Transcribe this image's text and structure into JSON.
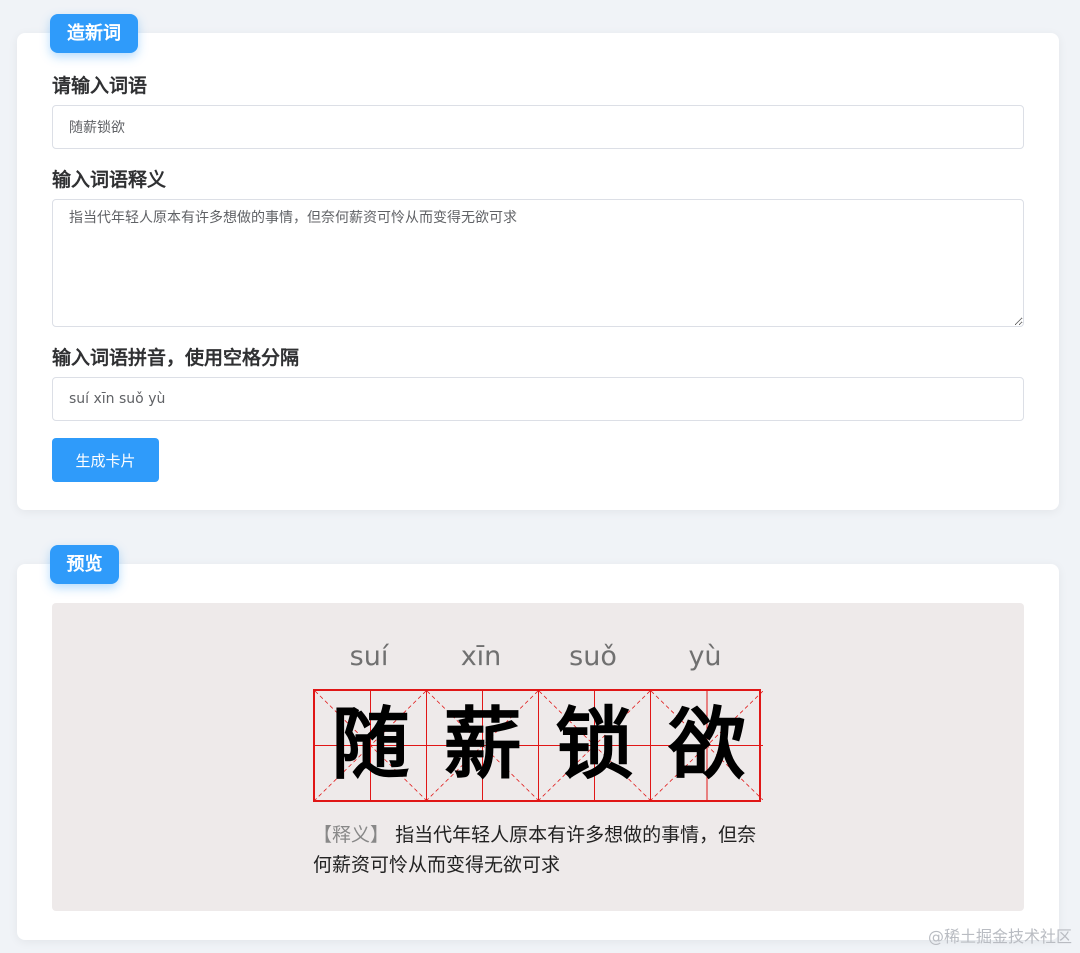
{
  "create_section": {
    "tag": "造新词",
    "word_label": "请输入词语",
    "word_value": "随薪锁欲",
    "meaning_label": "输入词语释义",
    "meaning_value": "指当代年轻人原本有许多想做的事情，但奈何薪资可怜从而变得无欲可求",
    "pinyin_label": "输入词语拼音，使用空格分隔",
    "pinyin_value": "suí xīn suǒ yù",
    "generate_button": "生成卡片"
  },
  "preview_section": {
    "tag": "预览",
    "pinyin": [
      "suí",
      "xīn",
      "suǒ",
      "yù"
    ],
    "characters": [
      "随",
      "薪",
      "锁",
      "欲"
    ],
    "meaning_label": "【释义】",
    "meaning_text": "指当代年轻人原本有许多想做的事情，但奈何薪资可怜从而变得无欲可求"
  },
  "watermark": "@稀土掘金技术社区",
  "colors": {
    "accent": "#2f9bfa",
    "grid_red": "#e01616",
    "page_bg": "#f0f3f7",
    "preview_bg": "#eeeaea"
  }
}
